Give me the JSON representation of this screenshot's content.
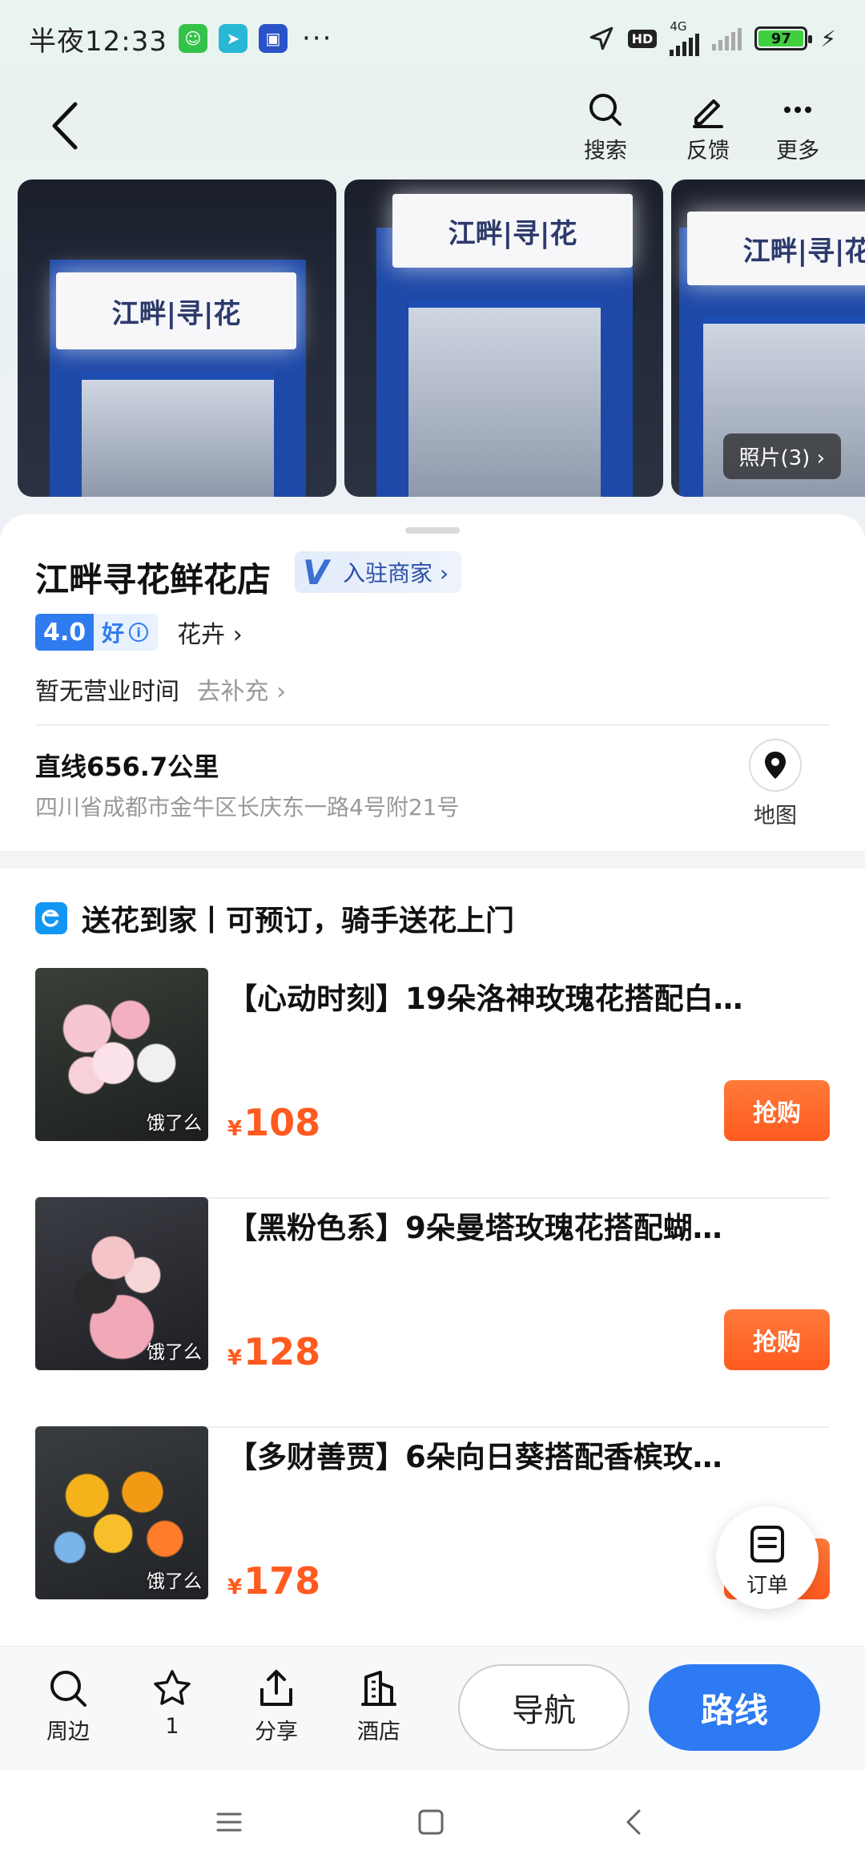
{
  "status_bar": {
    "time": "半夜12:33",
    "more": "···",
    "network": "4G",
    "hd": "HD",
    "battery": "97"
  },
  "nav": {
    "search_label": "搜索",
    "feedback_label": "反馈",
    "more_label": "更多"
  },
  "photos": {
    "count_label": "照片(3) ›",
    "sign_text": "江畔|寻|花"
  },
  "shop": {
    "name": "江畔寻花鲜花店",
    "merchant_tag": "入驻商家 ›",
    "rating_score": "4.0",
    "rating_word": "好",
    "category": "花卉 ›",
    "hours": "暂无营业时间",
    "hours_action": "去补充 ›",
    "distance": "直线656.7公里",
    "address": "四川省成都市金牛区长庆东一路4号附21号",
    "map_label": "地图"
  },
  "delivery": {
    "title": "送花到家丨可预订，骑手送花上门",
    "products": [
      {
        "name": "【心动时刻】19朵洛神玫瑰花搭配白…",
        "currency": "¥",
        "price": "108",
        "source_tag": "饿了么",
        "buy_label": "抢购"
      },
      {
        "name": "【黑粉色系】9朵曼塔玫瑰花搭配蝴…",
        "currency": "¥",
        "price": "128",
        "source_tag": "饿了么",
        "buy_label": "抢购"
      },
      {
        "name": "【多财善贾】6朵向日葵搭配香槟玫…",
        "currency": "¥",
        "price": "178",
        "source_tag": "饿了么",
        "buy_label": "抢购"
      }
    ]
  },
  "order_fab": {
    "label": "订单"
  },
  "bottom_bar": {
    "nearby": "周边",
    "favorites": "1",
    "share": "分享",
    "hotel": "酒店",
    "navigate": "导航",
    "route": "路线"
  },
  "colors": {
    "accent": "#2d7af2",
    "price": "#ff5a1f",
    "rating": "#2f7bf0"
  }
}
